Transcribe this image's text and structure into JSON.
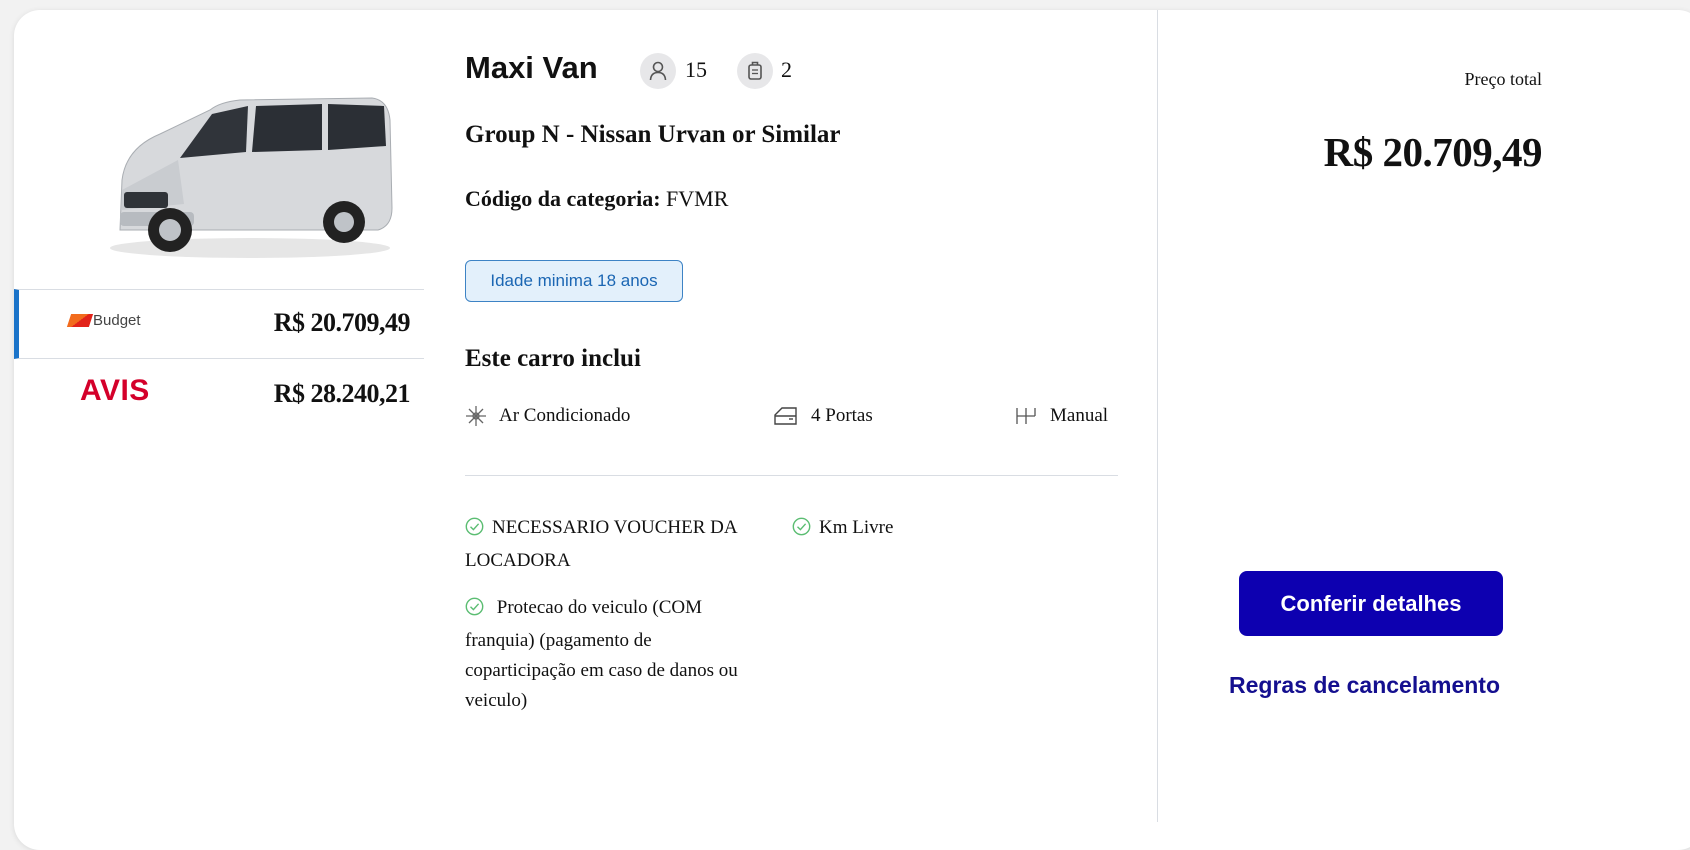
{
  "vehicle": {
    "name": "Maxi Van",
    "passengers": "15",
    "luggage": "2",
    "model": "Group N - Nissan Urvan or Similar",
    "category_label": "Código da categoria:",
    "category_code": "FVMR",
    "age_badge": "Idade minima 18 anos"
  },
  "vendors": [
    {
      "logo_text": "Budget",
      "price": "R$ 20.709,49",
      "selected": true
    },
    {
      "logo_text": "AVIS",
      "price": "R$ 28.240,21",
      "selected": false
    }
  ],
  "includes": {
    "title": "Este carro inclui",
    "features": [
      {
        "icon": "snowflake-icon",
        "label": "Ar Condicionado"
      },
      {
        "icon": "car-door-icon",
        "label": "4 Portas"
      },
      {
        "icon": "gear-shift-icon",
        "label": "Manual"
      }
    ],
    "perks": [
      {
        "icon": "check-circle-icon",
        "line1": "NECESSARIO VOUCHER DA",
        "line2": "LOCADORA"
      },
      {
        "icon": "check-circle-icon",
        "line1": "Km Livre"
      },
      {
        "icon": "check-circle-icon",
        "line1": "Protecao do veiculo (COM",
        "line2": "franquia) (pagamento de",
        "line3": "coparticipação em caso de danos ou",
        "line4": "veiculo)"
      }
    ]
  },
  "summary": {
    "total_label": "Preço total",
    "total_price": "R$ 20.709,49",
    "details_button": "Conferir detalhes",
    "cancel_link": "Regras de cancelamento"
  },
  "colors": {
    "accent": "#0d00b0",
    "badge_border": "#3d83c5",
    "avis_red": "#d4002a",
    "check_green": "#4caf50"
  }
}
